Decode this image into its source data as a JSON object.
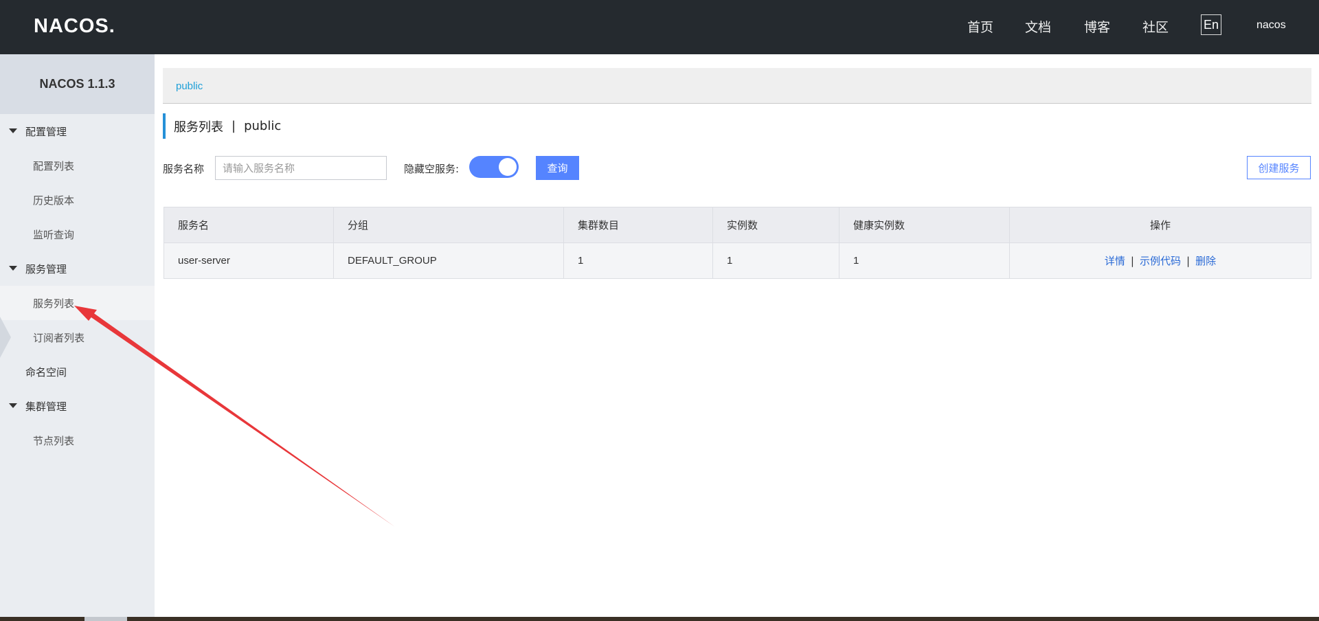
{
  "header": {
    "logo": "NACOS.",
    "nav": [
      "首页",
      "文档",
      "博客",
      "社区"
    ],
    "lang": "En",
    "user": "nacos"
  },
  "sidebar": {
    "title": "NACOS 1.1.3",
    "groups": [
      {
        "label": "配置管理",
        "items": [
          "配置列表",
          "历史版本",
          "监听查询"
        ]
      },
      {
        "label": "服务管理",
        "items": [
          "服务列表",
          "订阅者列表"
        ]
      },
      {
        "label": "命名空间"
      },
      {
        "label": "集群管理",
        "items": [
          "节点列表"
        ]
      }
    ],
    "active": "服务列表"
  },
  "main": {
    "breadcrumb": "public",
    "title": "服务列表",
    "title_sep": "|",
    "namespace": "public",
    "filter": {
      "name_label": "服务名称",
      "name_placeholder": "请输入服务名称",
      "hide_empty_label": "隐藏空服务:",
      "hide_empty_on": true,
      "query_label": "查询",
      "create_label": "创建服务"
    },
    "table": {
      "columns": [
        "服务名",
        "分组",
        "集群数目",
        "实例数",
        "健康实例数",
        "操作"
      ],
      "rows": [
        {
          "name": "user-server",
          "group": "DEFAULT_GROUP",
          "clusters": "1",
          "instances": "1",
          "healthy": "1"
        }
      ],
      "actions": [
        "详情",
        "示例代码",
        "删除"
      ],
      "action_sep": "|"
    }
  },
  "colors": {
    "topbar": "#252a2f",
    "accent": "#5584ff",
    "link": "#2a6ad6",
    "annotation_arrow": "#e8373a"
  }
}
